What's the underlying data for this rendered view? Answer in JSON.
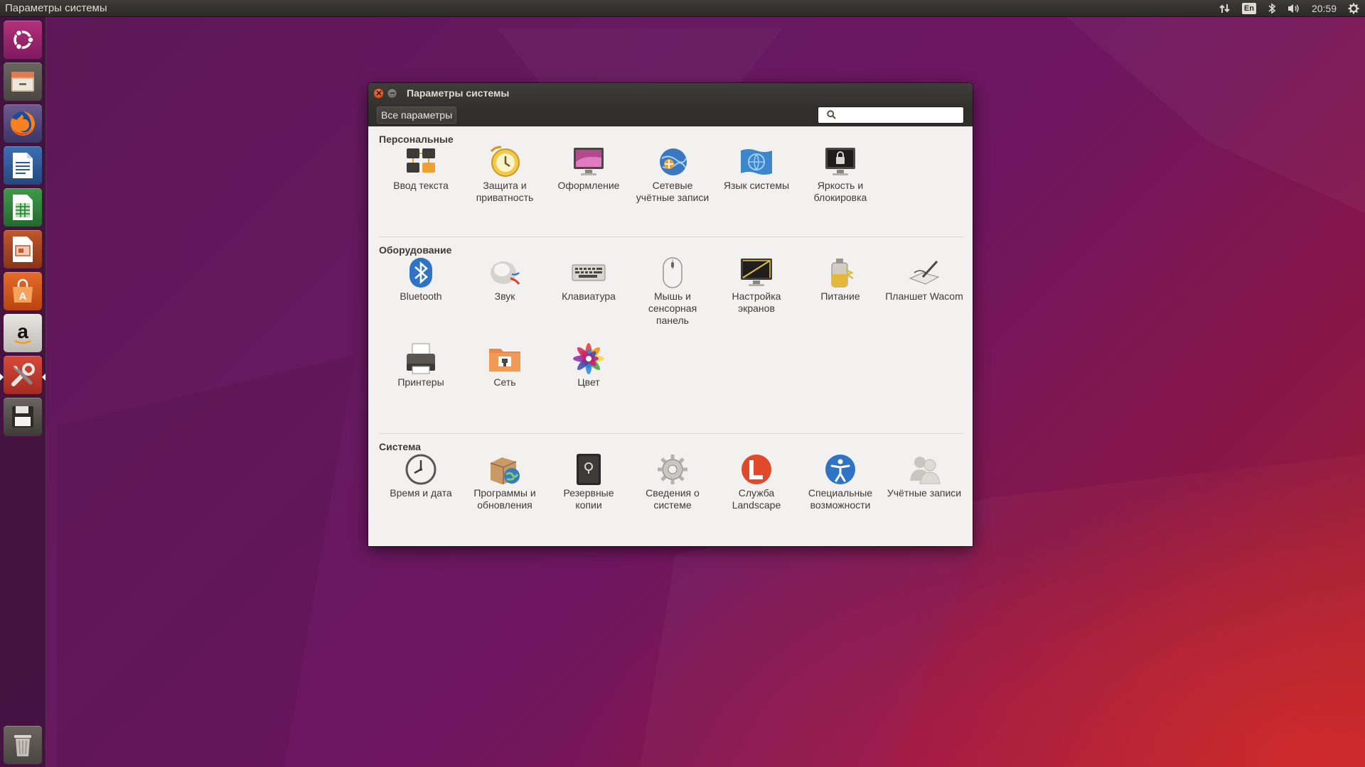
{
  "top_panel": {
    "title": "Параметры системы",
    "language": "En",
    "time": "20:59"
  },
  "launcher": {
    "items": [
      {
        "name": "dash-icon"
      },
      {
        "name": "files-icon"
      },
      {
        "name": "firefox-icon"
      },
      {
        "name": "writer-icon"
      },
      {
        "name": "calc-icon"
      },
      {
        "name": "impress-icon"
      },
      {
        "name": "software-center-icon"
      },
      {
        "name": "amazon-icon"
      },
      {
        "name": "system-settings-icon"
      },
      {
        "name": "save-drive-icon"
      }
    ],
    "trash": "trash-icon"
  },
  "window": {
    "title": "Параметры системы",
    "all_settings": "Все параметры",
    "search_placeholder": "",
    "sections": [
      {
        "title": "Персональные",
        "items": [
          {
            "label": "Ввод текста",
            "icon": "text-entry-icon"
          },
          {
            "label": "Защита и приватность",
            "icon": "security-privacy-icon"
          },
          {
            "label": "Оформление",
            "icon": "appearance-icon"
          },
          {
            "label": "Сетевые учётные записи",
            "icon": "online-accounts-icon"
          },
          {
            "label": "Язык системы",
            "icon": "language-icon"
          },
          {
            "label": "Яркость и блокировка",
            "icon": "brightness-lock-icon"
          }
        ]
      },
      {
        "title": "Оборудование",
        "items": [
          {
            "label": "Bluetooth",
            "icon": "bluetooth-icon"
          },
          {
            "label": "Звук",
            "icon": "sound-icon"
          },
          {
            "label": "Клавиатура",
            "icon": "keyboard-icon"
          },
          {
            "label": "Мышь и сенсорная панель",
            "icon": "mouse-icon"
          },
          {
            "label": "Настройка экранов",
            "icon": "displays-icon"
          },
          {
            "label": "Питание",
            "icon": "power-icon"
          },
          {
            "label": "Планшет Wacom",
            "icon": "wacom-tablet-icon"
          },
          {
            "label": "Принтеры",
            "icon": "printer-icon"
          },
          {
            "label": "Сеть",
            "icon": "network-icon"
          },
          {
            "label": "Цвет",
            "icon": "color-icon"
          }
        ]
      },
      {
        "title": "Система",
        "items": [
          {
            "label": "Время и дата",
            "icon": "clock-icon"
          },
          {
            "label": "Программы и обновления",
            "icon": "software-updates-icon"
          },
          {
            "label": "Резервные копии",
            "icon": "backups-icon"
          },
          {
            "label": "Сведения о системе",
            "icon": "details-gear-icon"
          },
          {
            "label": "Служба Landscape",
            "icon": "landscape-icon"
          },
          {
            "label": "Специальные возможности",
            "icon": "accessibility-icon"
          },
          {
            "label": "Учётные записи",
            "icon": "user-accounts-icon"
          }
        ]
      }
    ]
  }
}
